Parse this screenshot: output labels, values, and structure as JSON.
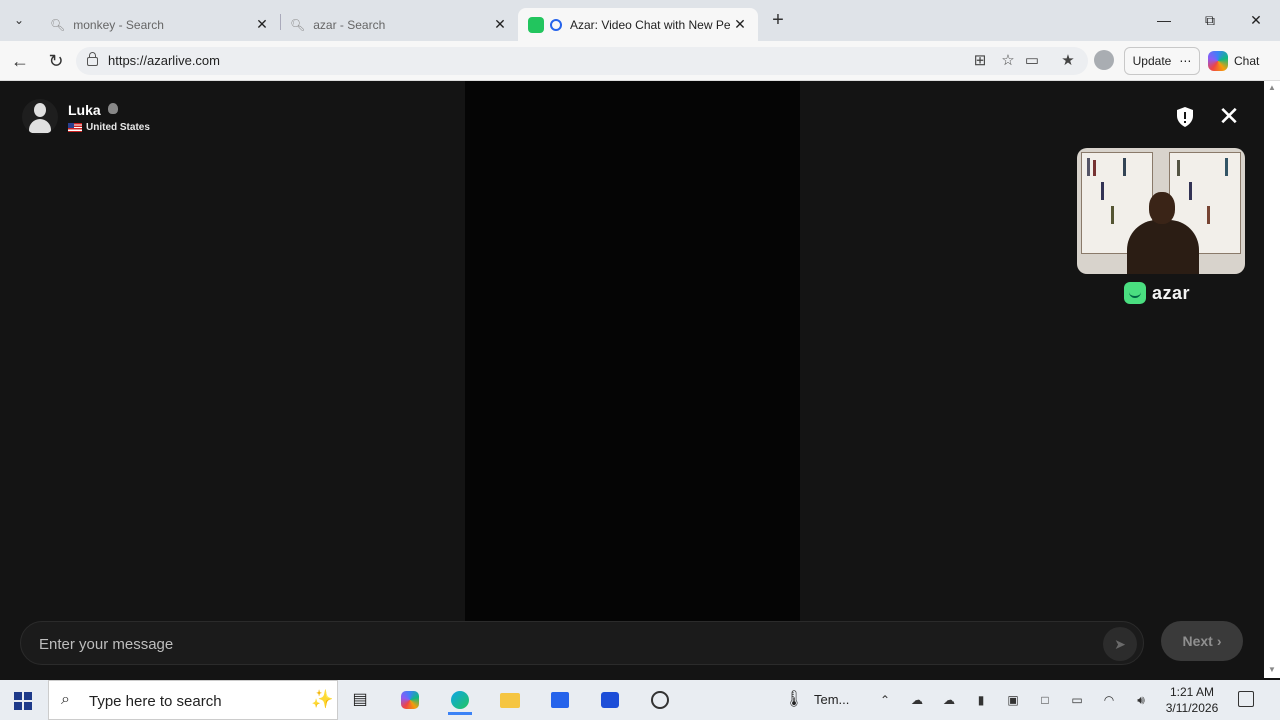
{
  "browser": {
    "tabs": [
      {
        "title": "monkey - Search",
        "active": false
      },
      {
        "title": "azar - Search",
        "active": false
      },
      {
        "title": "Azar: Video Chat with New Pe",
        "active": true
      }
    ],
    "url": "https://azarlive.com",
    "update_label": "Update",
    "chat_label": "Chat"
  },
  "peer": {
    "name": "Luka",
    "country": "United States"
  },
  "brand": {
    "logo_text": "azar",
    "accent": "#4ade80"
  },
  "chat": {
    "message_placeholder": "Enter your message",
    "next_label": "Next"
  },
  "taskbar": {
    "search_placeholder": "Type here to search",
    "weather_label": "Tem...",
    "time": "1:21 AM",
    "date": "3/11/2026"
  }
}
